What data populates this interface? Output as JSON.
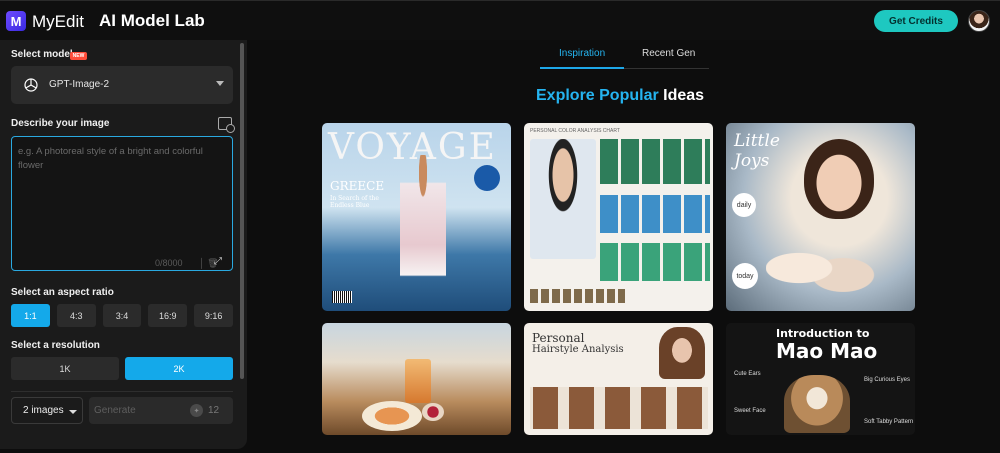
{
  "header": {
    "logo_letter": "M",
    "brand": "MyEdit",
    "title": "AI Model Lab",
    "get_credits": "Get Credits"
  },
  "sidebar": {
    "select_model_label": "Select model",
    "new_badge": "NEW",
    "model_name": "GPT-Image-2",
    "describe_label": "Describe your image",
    "prompt_placeholder": "e.g. A photoreal style of a bright and colorful flower",
    "char_count": "0/8000",
    "aspect_label": "Select an aspect ratio",
    "aspect_ratios": [
      "1:1",
      "4:3",
      "3:4",
      "16:9",
      "9:16"
    ],
    "aspect_selected": "1:1",
    "resolution_label": "Select a resolution",
    "resolutions": [
      "1K",
      "2K"
    ],
    "resolution_selected": "2K",
    "image_count": "2 images",
    "generate_label": "Generate",
    "credit_cost": "12"
  },
  "main": {
    "tabs": [
      "Inspiration",
      "Recent Gen"
    ],
    "active_tab": "Inspiration",
    "explore_title_accent": "Explore Popular",
    "explore_title_rest": "Ideas",
    "cards": [
      {
        "name": "voyage-magazine-card",
        "headline": "VOYAGE",
        "subhead": "GREECE",
        "tagline": "In Search of the Endless Blue"
      },
      {
        "name": "personal-color-card",
        "headline": "PERSONAL COLOR ANALYSIS CHART"
      },
      {
        "name": "little-joys-card",
        "headline": "Little Joys",
        "tag1": "daily",
        "tag2": "today"
      },
      {
        "name": "picnic-card",
        "headline": ""
      },
      {
        "name": "hairstyle-analysis-card",
        "headline": "Personal",
        "subhead": "Hairstyle Analysis"
      },
      {
        "name": "mao-mao-card",
        "headline": "Introduction to",
        "subhead": "Mao Mao",
        "caption1": "Cute Ears",
        "caption2": "Big Curious Eyes",
        "caption3": "Sweet Face",
        "caption4": "Soft Tabby Pattern"
      }
    ]
  }
}
